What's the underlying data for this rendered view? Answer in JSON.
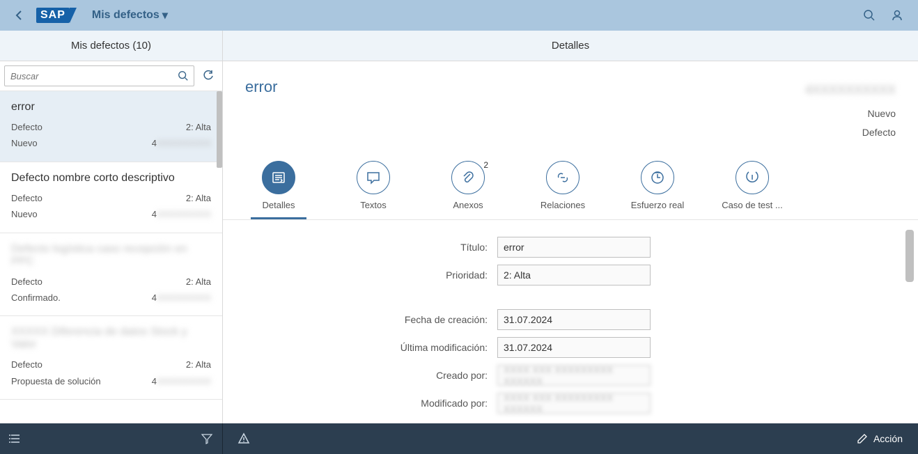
{
  "shell": {
    "logo_text": "SAP",
    "nav_title": "Mis defectos"
  },
  "master": {
    "title": "Mis defectos (10)",
    "search_placeholder": "Buscar",
    "items": [
      {
        "title": "error",
        "type": "Defecto",
        "priority": "2: Alta",
        "status": "Nuevo",
        "id": "4",
        "id_blur": true,
        "selected": true
      },
      {
        "title": "Defecto nombre corto descriptivo",
        "type": "Defecto",
        "priority": "2: Alta",
        "status": "Nuevo",
        "id": "4",
        "id_blur": true
      },
      {
        "title": "Defecto logística caso recepción en PPC",
        "title_blur": true,
        "type": "Defecto",
        "priority": "2: Alta",
        "status": "Confirmado.",
        "id": "4",
        "id_blur": true
      },
      {
        "title": "XXXXX Diferencia de datos Stock y Valor",
        "title_blur": true,
        "type": "Defecto",
        "priority": "2: Alta",
        "status": "Propuesta de solución",
        "id": "4",
        "id_blur": true
      }
    ]
  },
  "detail": {
    "header_title": "Detalles",
    "object_title": "error",
    "object_id": "4XXXXXXXXXX",
    "status": "Nuevo",
    "type": "Defecto",
    "tabs": [
      {
        "key": "detalles",
        "label": "Detalles",
        "active": true
      },
      {
        "key": "textos",
        "label": "Textos"
      },
      {
        "key": "anexos",
        "label": "Anexos",
        "badge": "2"
      },
      {
        "key": "relaciones",
        "label": "Relaciones"
      },
      {
        "key": "esfuerzo",
        "label": "Esfuerzo real"
      },
      {
        "key": "caso",
        "label": "Caso de test ..."
      }
    ],
    "form": {
      "titulo_label": "Título",
      "titulo_value": "error",
      "prioridad_label": "Prioridad",
      "prioridad_value": "2: Alta",
      "fecha_creacion_label": "Fecha de creación",
      "fecha_creacion_value": "31.07.2024",
      "ultima_modificacion_label": "Última modificación",
      "ultima_modificacion_value": "31.07.2024",
      "creado_por_label": "Creado por",
      "creado_por_value": "XXXX XXX XXXXXXXXX XXXXXX",
      "modificado_por_label": "Modificado por",
      "modificado_por_value": "XXXX XXX XXXXXXXXX XXXXXX"
    }
  },
  "footer": {
    "action_label": "Acción"
  }
}
